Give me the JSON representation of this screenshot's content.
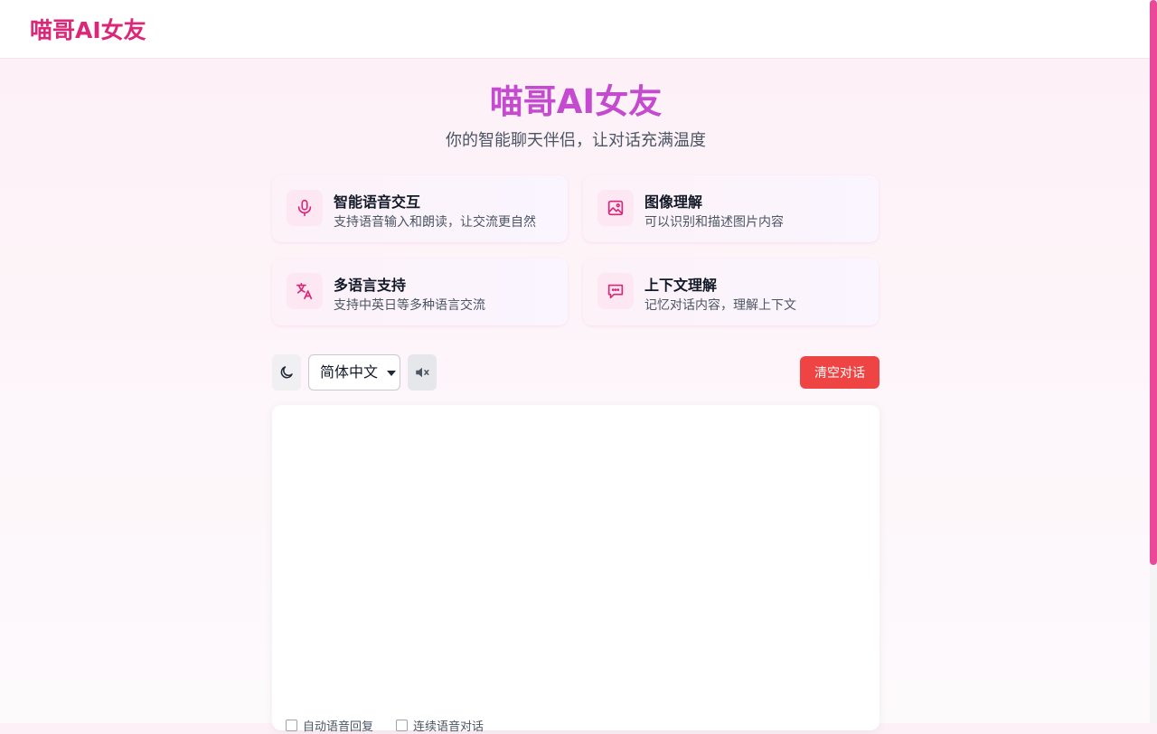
{
  "header": {
    "logo": "喵哥AI女友"
  },
  "hero": {
    "title": "喵哥AI女友",
    "subtitle": "你的智能聊天伴侣，让对话充满温度"
  },
  "features": [
    {
      "icon": "microphone-icon",
      "title": "智能语音交互",
      "desc": "支持语音输入和朗读，让交流更自然"
    },
    {
      "icon": "image-icon",
      "title": "图像理解",
      "desc": "可以识别和描述图片内容"
    },
    {
      "icon": "translate-icon",
      "title": "多语言支持",
      "desc": "支持中英日等多种语言交流"
    },
    {
      "icon": "chat-bubble-icon",
      "title": "上下文理解",
      "desc": "记忆对话内容，理解上下文"
    }
  ],
  "toolbar": {
    "theme_icon": "moon-icon",
    "language": "简体中文",
    "mute_icon": "speaker-muted-icon",
    "clear_label": "清空对话"
  },
  "options": {
    "auto_voice_reply": "自动语音回复",
    "continuous_voice": "连续语音对话"
  },
  "colors": {
    "accent": "#db2777",
    "title_gradient": "#c44bd0",
    "danger": "#ef4444"
  }
}
